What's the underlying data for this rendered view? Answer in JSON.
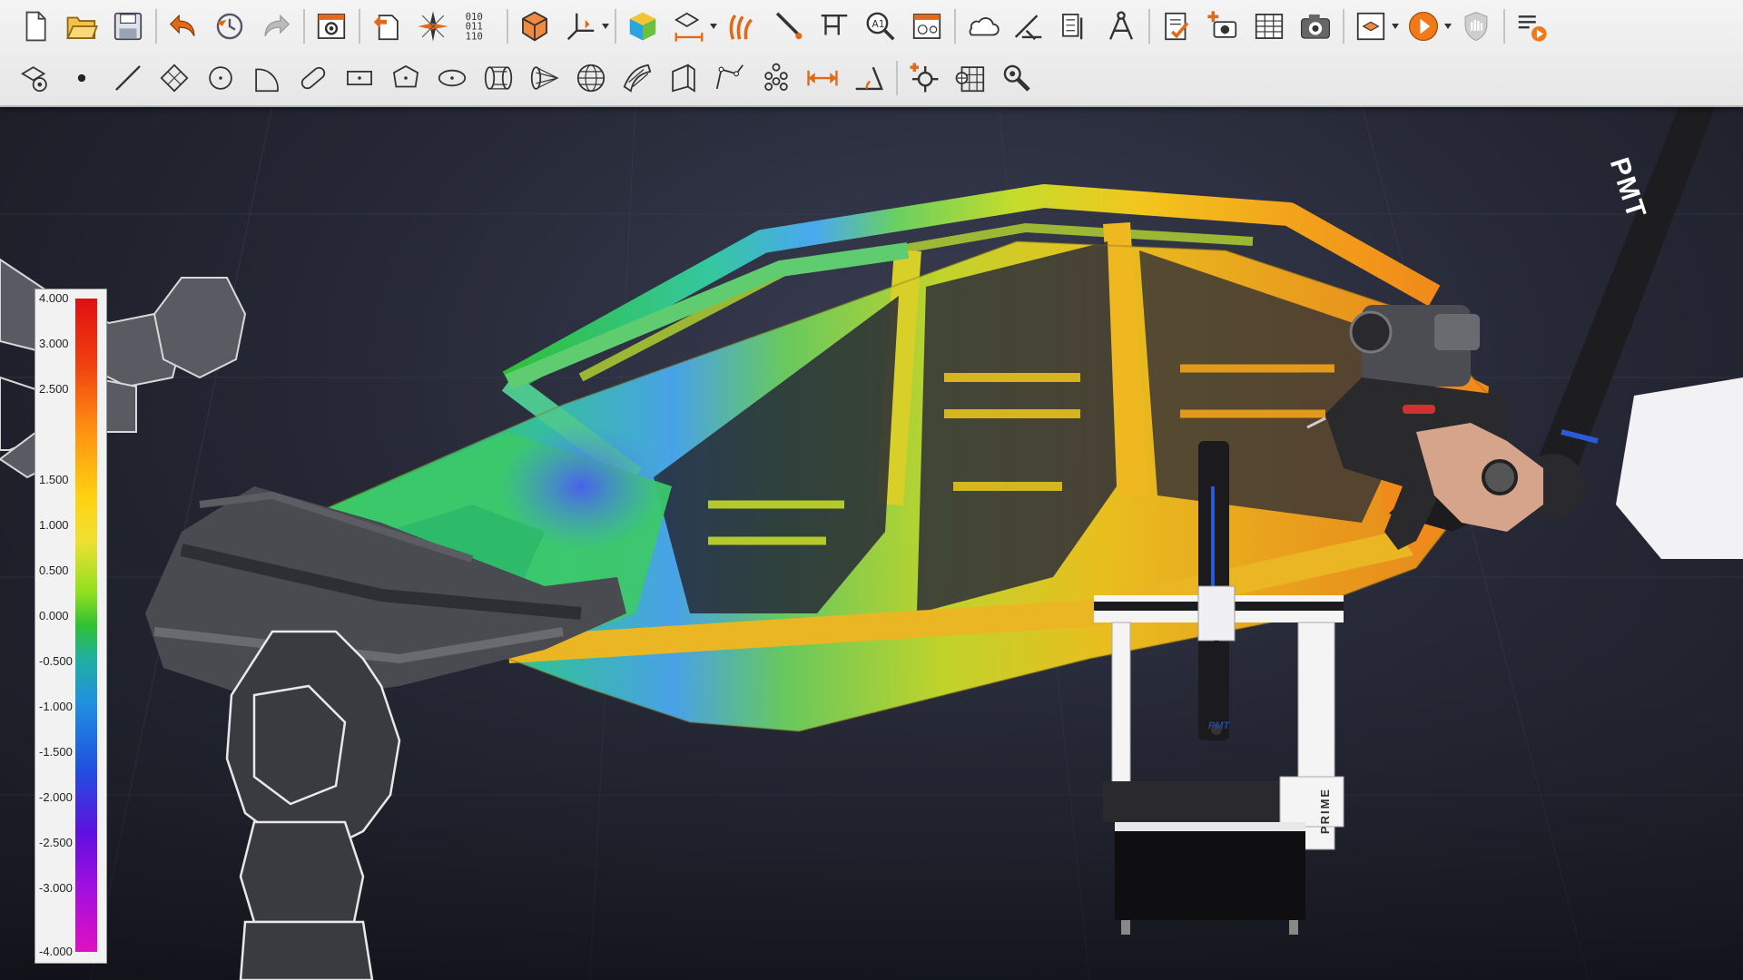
{
  "toolbar": {
    "row1": [
      "new-file-icon",
      "open-folder-icon",
      "save-icon",
      "undo-icon",
      "undo-history-icon",
      "redo-icon",
      "settings-icon",
      "export-icon",
      "compass-icon",
      "binary-data-icon",
      "cube-view-icon",
      "coordinate-system-icon",
      "color-cube-icon",
      "probe-scan-icon",
      "hand-scan-icon",
      "probe-icon",
      "caliper-icon",
      "annotation-search-icon",
      "report-grid-icon",
      "cloud-measure-icon",
      "gauge-icon",
      "checklist-gauge-icon",
      "compass-tool-icon",
      "checklist-icon",
      "add-camera-icon",
      "table-icon",
      "camera-icon",
      "layers-icon",
      "play-icon",
      "stop-hand-icon",
      "playlist-icon"
    ],
    "row2": [
      "point-cloud-icon",
      "point-icon",
      "line-icon",
      "plane-icon",
      "circle-icon",
      "arc-icon",
      "slot-icon",
      "rectangle-icon",
      "polygon-icon",
      "ellipse-icon",
      "cylinder-icon",
      "cone-icon",
      "sphere-icon",
      "surface-icon",
      "prism-icon",
      "polyline-icon",
      "point-group-icon",
      "distance-icon",
      "angle-icon",
      "target-icon",
      "grid-target-icon",
      "settings-wrench-icon"
    ]
  },
  "legend": {
    "labels": [
      "4.000",
      "3.000",
      "2.500",
      "1.500",
      "1.000",
      "0.500",
      "0.000",
      "-0.500",
      "-1.000",
      "-1.500",
      "-2.000",
      "-2.500",
      "-3.000",
      "-4.000"
    ],
    "colors": [
      "#e01010",
      "#ff9010",
      "#30c030",
      "#2050e0",
      "#e010c0"
    ]
  },
  "brand": {
    "arm_logo": "PMT",
    "cmm_logo": "PMT",
    "cmm_model": "PRIME"
  }
}
